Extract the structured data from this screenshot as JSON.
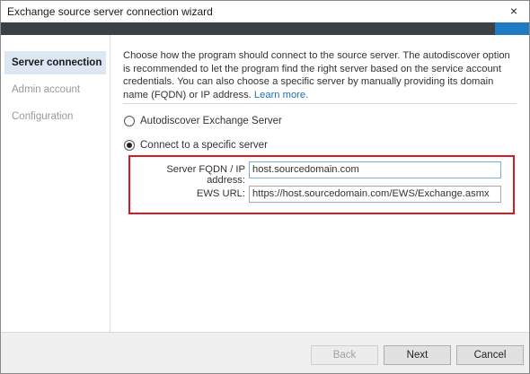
{
  "window": {
    "title": "Exchange source server connection wizard",
    "close_icon": "×"
  },
  "sidebar": {
    "items": [
      {
        "label": "Server connection",
        "state": "active"
      },
      {
        "label": "Admin account",
        "state": "disabled"
      },
      {
        "label": "Configuration",
        "state": "disabled"
      }
    ]
  },
  "main": {
    "description": "Choose how the program should connect to the source server. The autodiscover option is recommended to let the program find the right server based on the service account credentials. You can also choose a specific server by manually providing its domain name (FQDN) or IP address.",
    "learn_more": "Learn more.",
    "options": [
      {
        "label": "Autodiscover Exchange Server",
        "checked": false
      },
      {
        "label": "Connect to a specific server",
        "checked": true
      }
    ],
    "fields": {
      "fqdn": {
        "label": "Server FQDN / IP address:",
        "value": "host.sourcedomain.com"
      },
      "ews": {
        "label": "EWS URL:",
        "value": "https://host.sourcedomain.com/EWS/Exchange.asmx"
      }
    }
  },
  "footer": {
    "back_label": "Back",
    "next_label": "Next",
    "cancel_label": "Cancel"
  },
  "colors": {
    "accent": "#1f7ac2",
    "highlight": "#d61a24",
    "active_nav": "#dce7f3",
    "link": "#1f6fb8"
  }
}
